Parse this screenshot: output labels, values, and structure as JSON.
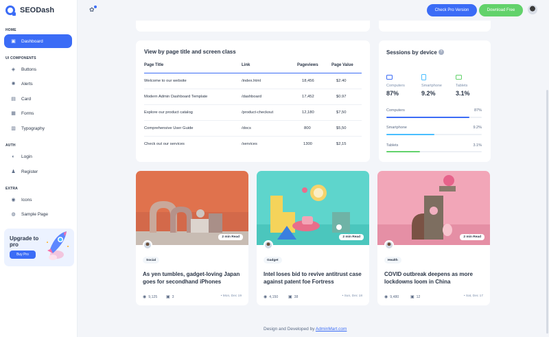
{
  "brand": {
    "name": "SEODash"
  },
  "sidebar": {
    "sections": [
      "HOME",
      "UI COMPONENTS",
      "AUTH",
      "EXTRA"
    ],
    "items": [
      {
        "label": "Dashboard",
        "icon": "dashboard-icon"
      },
      {
        "label": "Buttons",
        "icon": "layers-icon"
      },
      {
        "label": "Alerts",
        "icon": "alert-icon"
      },
      {
        "label": "Card",
        "icon": "card-icon"
      },
      {
        "label": "Forms",
        "icon": "file-icon"
      },
      {
        "label": "Typography",
        "icon": "text-icon"
      },
      {
        "label": "Login",
        "icon": "login-icon"
      },
      {
        "label": "Register",
        "icon": "user-plus-icon"
      },
      {
        "label": "Icons",
        "icon": "mood-icon"
      },
      {
        "label": "Sample Page",
        "icon": "page-icon"
      }
    ],
    "upgrade": {
      "title": "Upgrade to pro",
      "button": "Buy Pro"
    }
  },
  "header": {
    "check_pro": "Check Pro Version",
    "download": "Download Free"
  },
  "table": {
    "title": "View by page title and screen class",
    "headers": [
      "Page Title",
      "Link",
      "Pageviews",
      "Page Value"
    ],
    "rows": [
      [
        "Welcome to our website",
        "/index.html",
        "18,456",
        "$2.40"
      ],
      [
        "Modern Admin Dashboard Template",
        "/dashboard",
        "17,452",
        "$0.97"
      ],
      [
        "Explore our product catalog",
        "/product-checkout",
        "12,180",
        "$7,50"
      ],
      [
        "Comprehensive User Guide",
        "/docs",
        "800",
        "$5,50"
      ],
      [
        "Check out our services",
        "/services",
        "1300",
        "$2,15"
      ]
    ]
  },
  "sessions": {
    "title": "Sessions by device",
    "devices": [
      {
        "label": "Computers",
        "value": "87%",
        "color": "#3b6cf6"
      },
      {
        "label": "Smartphone",
        "value": "9.2%",
        "color": "#49beff"
      },
      {
        "label": "Tablets",
        "value": "3.1%",
        "color": "#62d26b"
      }
    ],
    "bars": [
      {
        "label": "Computers",
        "pct": "87%",
        "fraction": 0.87,
        "color": "#3b6cf6"
      },
      {
        "label": "Smartphone",
        "pct": "9.2%",
        "fraction": 0.5,
        "color": "#49beff"
      },
      {
        "label": "Tablets",
        "pct": "3.1%",
        "fraction": 0.35,
        "color": "#62d26b"
      }
    ]
  },
  "blogs": [
    {
      "read": "2 min Read",
      "tag": "Social",
      "title": "As yen tumbles, gadget-loving Japan goes for secondhand iPhones",
      "views": "9,125",
      "comments": "3",
      "date": "Mon, Dec 19"
    },
    {
      "read": "2 min Read",
      "tag": "Gadget",
      "title": "Intel loses bid to revive antitrust case against patent foe Fortress",
      "views": "4,150",
      "comments": "38",
      "date": "Sun, Dec 18"
    },
    {
      "read": "2 min Read",
      "tag": "Health",
      "title": "COVID outbreak deepens as more lockdowns loom in China",
      "views": "9,480",
      "comments": "12",
      "date": "Sat, Dec 17"
    }
  ],
  "footer": {
    "text": "Design and Developed by",
    "link": "AdminMart.com"
  }
}
